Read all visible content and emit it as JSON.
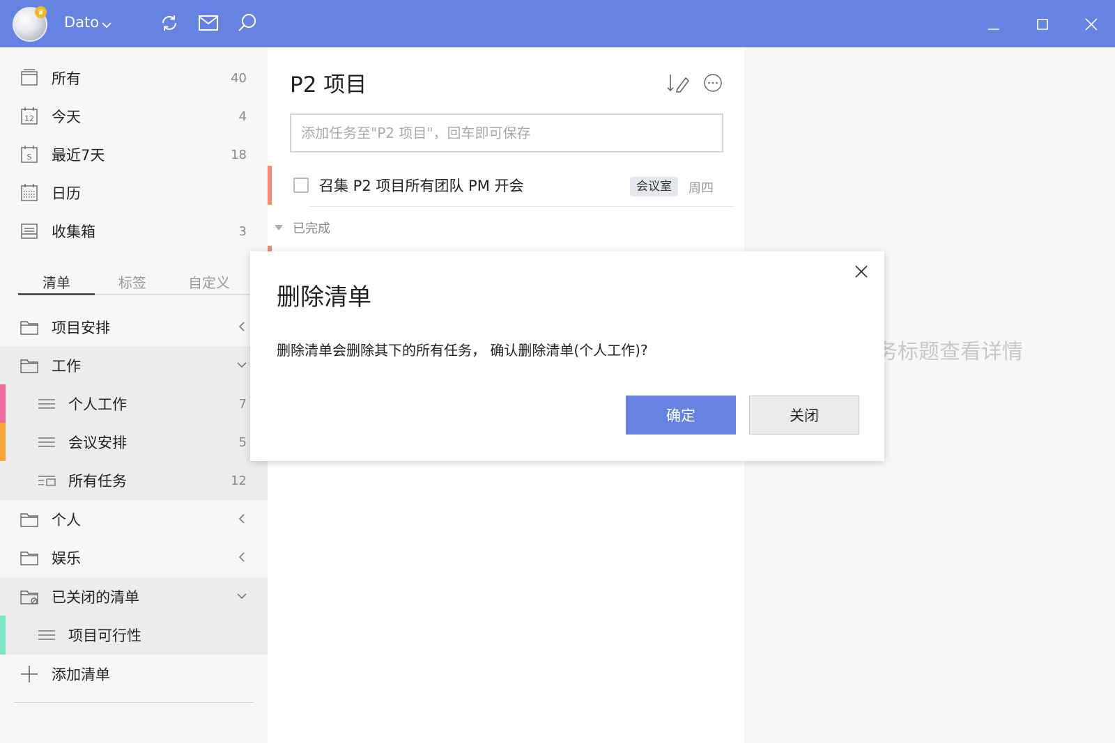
{
  "titlebar": {
    "app_name": "Dato",
    "icons": [
      "sync-icon",
      "mail-icon",
      "search-icon"
    ],
    "window_controls": [
      "minimize-icon",
      "maximize-icon",
      "close-icon"
    ],
    "bg_color": "#6682e2"
  },
  "sidebar": {
    "smart_lists": [
      {
        "label": "所有",
        "count": "40",
        "icon": "inbox-tray-icon"
      },
      {
        "label": "今天",
        "count": "4",
        "icon": "calendar-12-icon"
      },
      {
        "label": "最近7天",
        "count": "18",
        "icon": "calendar-week-icon"
      },
      {
        "label": "日历",
        "count": "",
        "icon": "calendar-grid-icon"
      },
      {
        "label": "收集箱",
        "count": "3",
        "icon": "collect-box-icon"
      }
    ],
    "tabs": [
      {
        "label": "清单",
        "active": true
      },
      {
        "label": "标签",
        "active": false
      },
      {
        "label": "自定义",
        "active": false
      }
    ],
    "folders": {
      "project": {
        "label": "项目安排"
      },
      "work": {
        "label": "工作"
      },
      "work_items": [
        {
          "label": "个人工作",
          "count": "7",
          "color": "#f06aa0"
        },
        {
          "label": "会议安排",
          "count": "5",
          "color": "#f7a63a"
        },
        {
          "label": "所有任务",
          "count": "12",
          "color": ""
        }
      ],
      "personal": {
        "label": "个人"
      },
      "fun": {
        "label": "娱乐"
      },
      "closed": {
        "label": "已关闭的清单"
      },
      "closed_items": [
        {
          "label": "项目可行性",
          "count": "",
          "color": "#7de5c8"
        }
      ]
    },
    "add_list_label": "添加清单"
  },
  "main": {
    "list_title": "P2 项目",
    "add_task_placeholder": "添加任务至\"P2 项目\"，回车即可保存",
    "tasks": [
      {
        "title": "召集 P2 项目所有团队 PM 开会",
        "tag": "会议室",
        "date": "周四"
      }
    ],
    "completed_label": "已完成"
  },
  "detail": {
    "hint": "务标题查看详情"
  },
  "dialog": {
    "title": "删除清单",
    "message": "删除清单会删除其下的所有任务， 确认删除清单(个人工作)?",
    "confirm_label": "确定",
    "close_label": "关闭"
  }
}
